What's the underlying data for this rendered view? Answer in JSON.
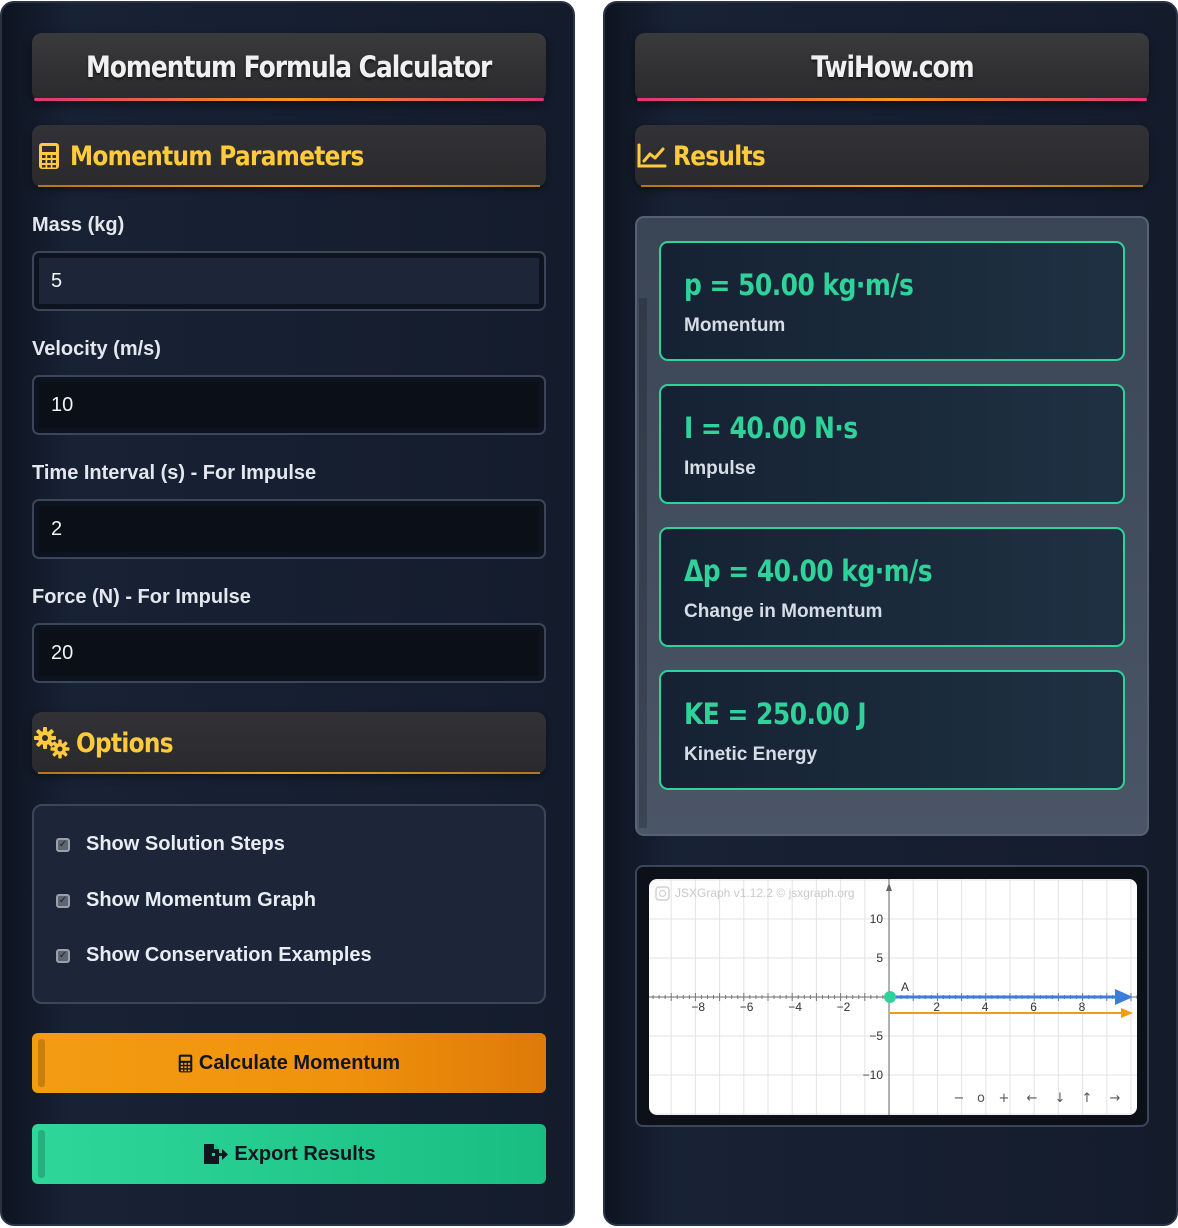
{
  "left": {
    "title": "Momentum Formula Calculator",
    "params_heading": "Momentum Parameters",
    "fields": [
      {
        "label": "Mass (kg)",
        "value": "5"
      },
      {
        "label": "Velocity (m/s)",
        "value": "10"
      },
      {
        "label": "Time Interval (s) - For Impulse",
        "value": "2"
      },
      {
        "label": "Force (N) - For Impulse",
        "value": "20"
      }
    ],
    "options_heading": "Options",
    "options": [
      {
        "label": "Show Solution Steps",
        "checked": true
      },
      {
        "label": "Show Momentum Graph",
        "checked": true
      },
      {
        "label": "Show Conservation Examples",
        "checked": true
      }
    ],
    "calculate_label": "Calculate Momentum",
    "export_label": "Export Results"
  },
  "right": {
    "title": "TwiHow.com",
    "results_heading": "Results",
    "results": [
      {
        "value": "p = 50.00 kg·m/s",
        "caption": "Momentum"
      },
      {
        "value": "I = 40.00 N·s",
        "caption": "Impulse"
      },
      {
        "value": "Δp = 40.00 kg·m/s",
        "caption": "Change in Momentum"
      },
      {
        "value": "KE = 250.00 J",
        "caption": "Kinetic Energy"
      }
    ],
    "graph": {
      "watermark": "JSXGraph v1.12.2 © jsxgraph.org",
      "point_label": "A",
      "x_ticks": [
        "−8",
        "−6",
        "−4",
        "−2",
        "2",
        "4",
        "6",
        "8"
      ],
      "y_ticks": [
        "10",
        "5",
        "−5",
        "−10"
      ],
      "nav": [
        "−",
        "o",
        "+",
        "←",
        "↓",
        "↑",
        "→"
      ],
      "colors": {
        "momentum_arrow": "#3b7ddd",
        "impulse_arrow": "#f39c12",
        "point": "#2fd39a"
      }
    }
  }
}
